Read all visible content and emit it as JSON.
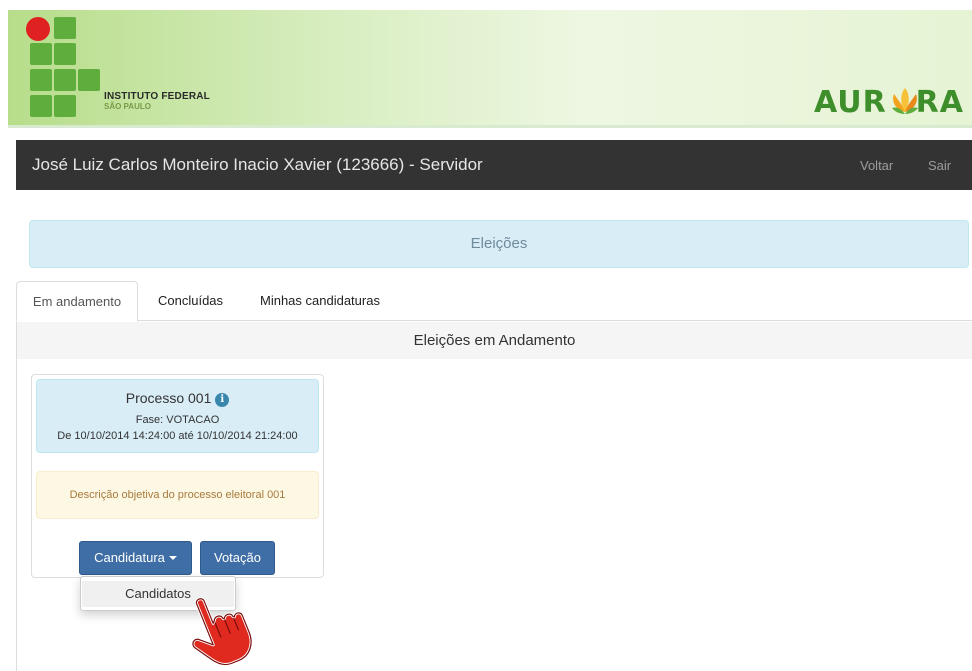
{
  "header": {
    "institute_name": "INSTITUTO FEDERAL",
    "institute_sub": "SÃO PAULO",
    "brand_left": "AUR",
    "brand_right": "RA",
    "colors": {
      "logo_green": "#5fad3c",
      "logo_red": "#e02121",
      "brand_green": "#3e8f2c"
    }
  },
  "navbar": {
    "user": "José Luiz Carlos Monteiro Inacio Xavier (123666) - Servidor",
    "back_label": "Voltar",
    "logout_label": "Sair"
  },
  "page_title": "Eleições",
  "tabs": [
    {
      "label": "Em andamento",
      "active": true
    },
    {
      "label": "Concluídas",
      "active": false
    },
    {
      "label": "Minhas candidaturas",
      "active": false
    }
  ],
  "section_title": "Eleições em Andamento",
  "card": {
    "title": "Processo 001",
    "info_icon": "info-icon",
    "phase": "Fase: VOTACAO",
    "dates": "De 10/10/2014 14:24:00 até 10/10/2014 21:24:00",
    "description": "Descrição objetiva do processo eleitoral 001",
    "candidatura_button": "Candidatura",
    "votacao_button": "Votação"
  },
  "dropdown": {
    "items": [
      "Candidatos"
    ]
  },
  "cursor": "hand-pointer-icon"
}
